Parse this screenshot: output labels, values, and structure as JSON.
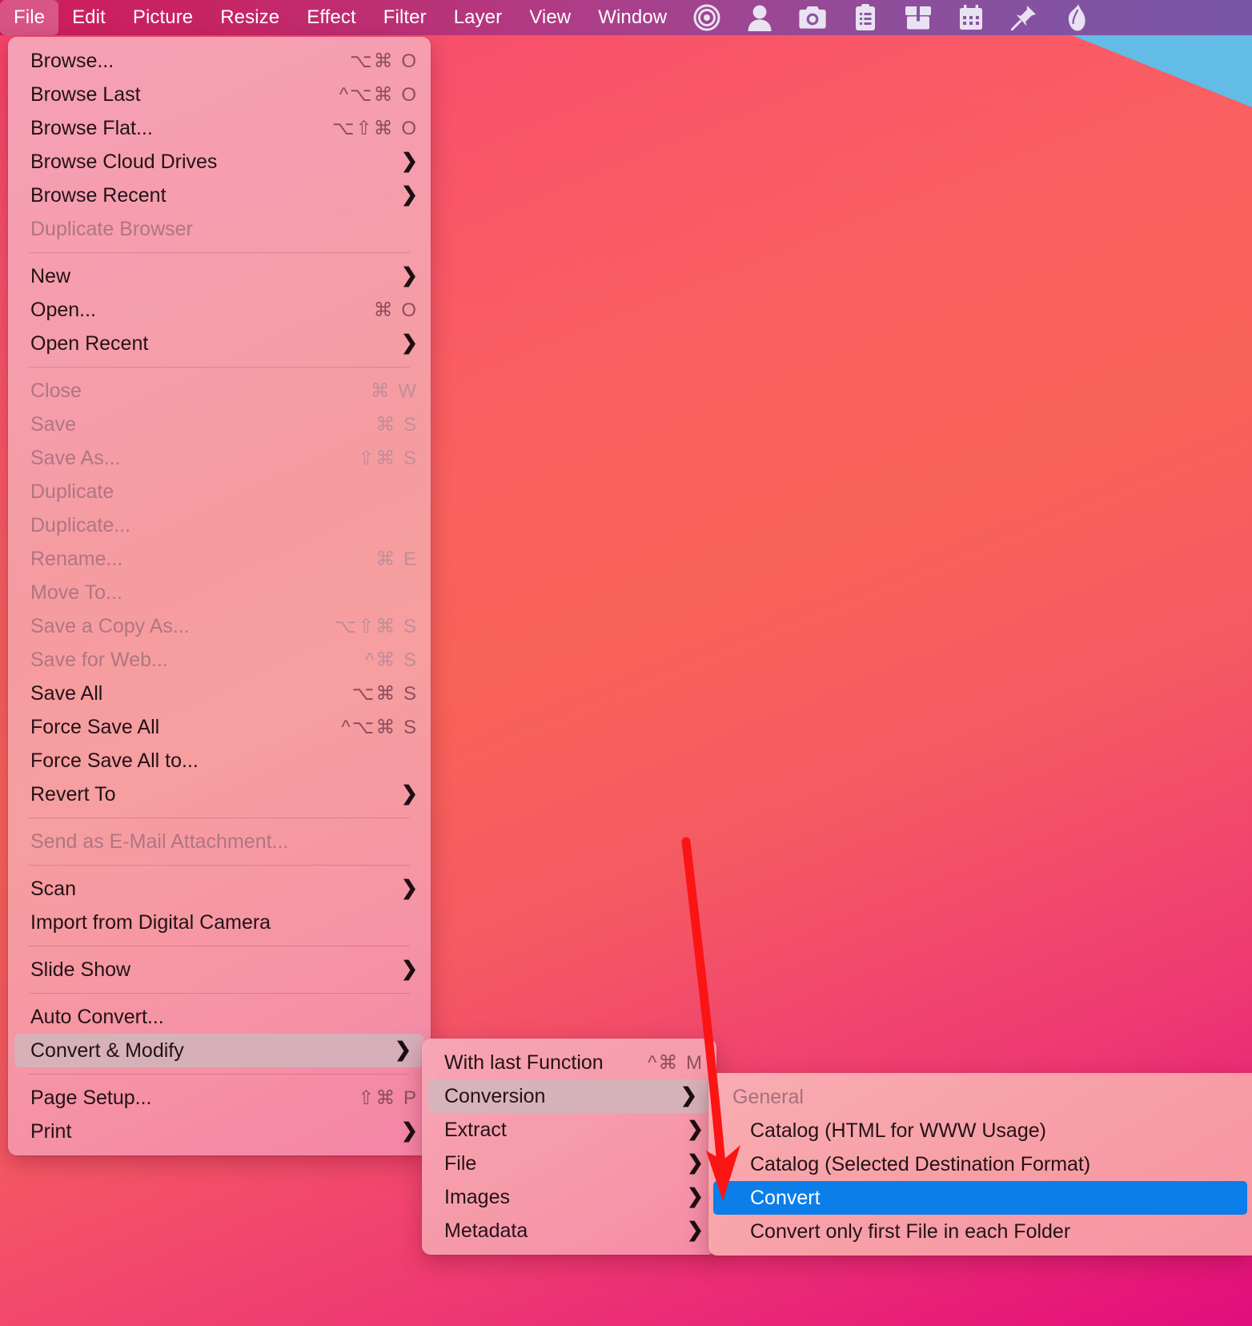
{
  "menubar": {
    "items": [
      {
        "label": "File",
        "active": true
      },
      {
        "label": "Edit",
        "active": false
      },
      {
        "label": "Picture",
        "active": false
      },
      {
        "label": "Resize",
        "active": false
      },
      {
        "label": "Effect",
        "active": false
      },
      {
        "label": "Filter",
        "active": false
      },
      {
        "label": "Layer",
        "active": false
      },
      {
        "label": "View",
        "active": false
      },
      {
        "label": "Window",
        "active": false
      }
    ],
    "icons": [
      {
        "name": "target-icon"
      },
      {
        "name": "user-icon"
      },
      {
        "name": "camera-icon"
      },
      {
        "name": "clipboard-icon"
      },
      {
        "name": "box-icon"
      },
      {
        "name": "calendar-icon"
      },
      {
        "name": "pin-icon"
      },
      {
        "name": "leaf-icon"
      }
    ]
  },
  "file_menu": {
    "items": [
      {
        "label": "Browse...",
        "shortcut": "⌥⌘ O",
        "arrow": false,
        "disabled": false,
        "selected": false
      },
      {
        "label": "Browse Last",
        "shortcut": "^⌥⌘ O",
        "arrow": false,
        "disabled": false,
        "selected": false
      },
      {
        "label": "Browse Flat...",
        "shortcut": "⌥⇧⌘ O",
        "arrow": false,
        "disabled": false,
        "selected": false
      },
      {
        "label": "Browse Cloud Drives",
        "shortcut": "",
        "arrow": true,
        "disabled": false,
        "selected": false
      },
      {
        "label": "Browse Recent",
        "shortcut": "",
        "arrow": true,
        "disabled": false,
        "selected": false
      },
      {
        "label": "Duplicate Browser",
        "shortcut": "",
        "arrow": false,
        "disabled": true,
        "selected": false
      },
      {
        "separator": true
      },
      {
        "label": "New",
        "shortcut": "",
        "arrow": true,
        "disabled": false,
        "selected": false
      },
      {
        "label": "Open...",
        "shortcut": "⌘ O",
        "arrow": false,
        "disabled": false,
        "selected": false
      },
      {
        "label": "Open Recent",
        "shortcut": "",
        "arrow": true,
        "disabled": false,
        "selected": false
      },
      {
        "separator": true
      },
      {
        "label": "Close",
        "shortcut": "⌘ W",
        "arrow": false,
        "disabled": true,
        "selected": false
      },
      {
        "label": "Save",
        "shortcut": "⌘ S",
        "arrow": false,
        "disabled": true,
        "selected": false
      },
      {
        "label": "Save As...",
        "shortcut": "⇧⌘ S",
        "arrow": false,
        "disabled": true,
        "selected": false
      },
      {
        "label": "Duplicate",
        "shortcut": "",
        "arrow": false,
        "disabled": true,
        "selected": false
      },
      {
        "label": "Duplicate...",
        "shortcut": "",
        "arrow": false,
        "disabled": true,
        "selected": false
      },
      {
        "label": "Rename...",
        "shortcut": "⌘ E",
        "arrow": false,
        "disabled": true,
        "selected": false
      },
      {
        "label": "Move To...",
        "shortcut": "",
        "arrow": false,
        "disabled": true,
        "selected": false
      },
      {
        "label": "Save a Copy As...",
        "shortcut": "⌥⇧⌘ S",
        "arrow": false,
        "disabled": true,
        "selected": false
      },
      {
        "label": "Save for Web...",
        "shortcut": "^⌘ S",
        "arrow": false,
        "disabled": true,
        "selected": false
      },
      {
        "label": "Save All",
        "shortcut": "⌥⌘ S",
        "arrow": false,
        "disabled": false,
        "selected": false
      },
      {
        "label": "Force Save All",
        "shortcut": "^⌥⌘ S",
        "arrow": false,
        "disabled": false,
        "selected": false
      },
      {
        "label": "Force Save All to...",
        "shortcut": "",
        "arrow": false,
        "disabled": false,
        "selected": false
      },
      {
        "label": "Revert To",
        "shortcut": "",
        "arrow": true,
        "disabled": false,
        "selected": false
      },
      {
        "separator": true
      },
      {
        "label": "Send as E-Mail Attachment...",
        "shortcut": "",
        "arrow": false,
        "disabled": true,
        "selected": false
      },
      {
        "separator": true
      },
      {
        "label": "Scan",
        "shortcut": "",
        "arrow": true,
        "disabled": false,
        "selected": false
      },
      {
        "label": "Import from Digital Camera",
        "shortcut": "",
        "arrow": false,
        "disabled": false,
        "selected": false
      },
      {
        "separator": true
      },
      {
        "label": "Slide Show",
        "shortcut": "",
        "arrow": true,
        "disabled": false,
        "selected": false
      },
      {
        "separator": true
      },
      {
        "label": "Auto Convert...",
        "shortcut": "",
        "arrow": false,
        "disabled": false,
        "selected": false
      },
      {
        "label": "Convert & Modify",
        "shortcut": "",
        "arrow": true,
        "disabled": false,
        "selected": true
      },
      {
        "separator": true
      },
      {
        "label": "Page Setup...",
        "shortcut": "⇧⌘ P",
        "arrow": false,
        "disabled": false,
        "selected": false
      },
      {
        "label": "Print",
        "shortcut": "",
        "arrow": true,
        "disabled": false,
        "selected": false
      }
    ]
  },
  "convert_modify_menu": {
    "items": [
      {
        "label": "With last Function",
        "shortcut": "^⌘ M",
        "arrow": false,
        "disabled": false,
        "selected": false
      },
      {
        "label": "Conversion",
        "shortcut": "",
        "arrow": true,
        "disabled": false,
        "selected": true
      },
      {
        "label": "Extract",
        "shortcut": "",
        "arrow": true,
        "disabled": false,
        "selected": false
      },
      {
        "label": "File",
        "shortcut": "",
        "arrow": true,
        "disabled": false,
        "selected": false
      },
      {
        "label": "Images",
        "shortcut": "",
        "arrow": true,
        "disabled": false,
        "selected": false
      },
      {
        "label": "Metadata",
        "shortcut": "",
        "arrow": true,
        "disabled": false,
        "selected": false
      }
    ]
  },
  "conversion_menu": {
    "items": [
      {
        "label": "General",
        "shortcut": "",
        "arrow": false,
        "header": true,
        "selected": false
      },
      {
        "label": "Catalog (HTML for WWW Usage)",
        "shortcut": "",
        "arrow": false,
        "header": false,
        "selected": false
      },
      {
        "label": "Catalog (Selected Destination Format)",
        "shortcut": "",
        "arrow": false,
        "header": false,
        "selected": false
      },
      {
        "label": "Convert",
        "shortcut": "",
        "arrow": false,
        "header": false,
        "selected": true
      },
      {
        "label": "Convert only first File in each Folder",
        "shortcut": "",
        "arrow": false,
        "header": false,
        "selected": false
      }
    ]
  },
  "annotation": {
    "color": "#fb1414",
    "type": "arrow-pointing-to-convert"
  },
  "colors": {
    "selection_blue": "#0b7eea",
    "menu_highlight": "#cdb9be",
    "menubar_left": "#c9185a",
    "menubar_right": "#7a56a6",
    "wallpaper_accent": "#63bce5"
  }
}
